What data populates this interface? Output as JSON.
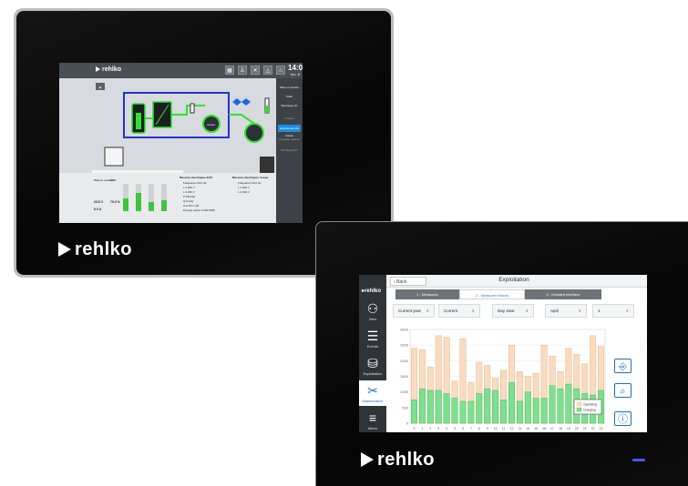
{
  "device1": {
    "brand": "rehlko",
    "screen": {
      "logo": "rehlko",
      "clock_time": "14:06",
      "clock_date": "lun. 8 Janv",
      "warning_text": "Vous pouvez ouvrir l'organe de coupure auxiliaire.",
      "tab_labels": [
        "Synthèse",
        "Mesures ECP",
        "Mesures Hôtes",
        "Sous-transformation",
        "Pilotes des batteries",
        "Aux. principales Transformations",
        "Etat"
      ],
      "side_menu": [
        {
          "label": "Mise en service",
          "highlight": false
        },
        {
          "label": "Trafic",
          "highlight": false
        },
        {
          "label": "Recharge AC",
          "highlight": false
        },
        {
          "label": "Groupe",
          "highlight": false
        },
        {
          "label": "Déploiement du réseau",
          "highlight": true
        },
        {
          "label": "Couplage alterné",
          "highlight": false
        },
        {
          "label": "Recharge DC",
          "highlight": false
        }
      ],
      "left_panel_labels": [
        "Batterie auxiliaire",
        "SOC",
        "23.8 V",
        "79.3 %",
        "0.0 A"
      ],
      "meas_title_1": "Mesures électriques ECP",
      "meas_title_2": "Mesures électriques réseau",
      "meas_rows_1": [
        "Fréquence 50.0 Hz",
        "L 1 400 V",
        "L 2 230 V",
        "P 150 kW",
        "Q 0 kvar",
        "Cos Phi 1.00",
        "Energie active 1.000 MWh"
      ],
      "meas_rows_2": [
        "Fréquence 50.0 Hz",
        "L 1 400 V",
        "L 2 230 V"
      ],
      "diagram_labels": [
        "230 kV",
        "Accumulateur",
        "Générateur",
        "3 kW"
      ]
    }
  },
  "device2": {
    "brand": "rehlko",
    "screen": {
      "logo": "rehlko",
      "back_label": "Back",
      "title": "Exploitation",
      "tabs": [
        {
          "label": "1 - Measures",
          "active": false
        },
        {
          "label": "2 - Measures history",
          "active": true
        },
        {
          "label": "3 - Detailed interface",
          "active": false
        }
      ],
      "selectors": [
        "Current year",
        "Current",
        "Day view",
        "April",
        "1"
      ],
      "sidebar": [
        {
          "label": "View",
          "icon": "people-icon",
          "active": false
        },
        {
          "label": "Events",
          "icon": "list-icon",
          "active": false
        },
        {
          "label": "Exploitation",
          "icon": "generator-icon",
          "active": false
        },
        {
          "label": "Maintenance",
          "icon": "wrench-icon",
          "active": true
        },
        {
          "label": "Menu",
          "icon": "menu-icon",
          "active": false
        }
      ],
      "action_buttons": [
        "export-icon",
        "zoom-icon",
        "info-icon"
      ]
    }
  },
  "colors": {
    "orange_bar": "#f9dcc0",
    "orange_border": "#e8b48a",
    "green_bar": "#7ee08e",
    "green_border": "#44b95c",
    "accent_blue": "#1e6fc0",
    "led": "#4f55e8"
  },
  "chart_data": {
    "type": "bar",
    "categories": [
      "0",
      "1",
      "2",
      "3",
      "4",
      "5",
      "6",
      "7",
      "8",
      "9",
      "10",
      "11",
      "12",
      "13",
      "14",
      "15",
      "16",
      "17",
      "18",
      "19",
      "20",
      "21",
      "22",
      "23"
    ],
    "ylim": [
      0,
      3000
    ],
    "yticks": [
      "3000",
      "2500",
      "2000",
      "1500",
      "1000",
      "500",
      "0"
    ],
    "series": [
      {
        "name": "Operating",
        "values": [
          2400,
          2350,
          1800,
          2800,
          2750,
          1350,
          2700,
          1300,
          1950,
          1850,
          1450,
          1700,
          2500,
          1650,
          1500,
          1600,
          2500,
          2150,
          1650,
          2400,
          2200,
          1900,
          2800,
          2450
        ]
      },
      {
        "name": "Charging",
        "values": [
          750,
          1100,
          1050,
          1050,
          950,
          800,
          700,
          700,
          950,
          1100,
          1050,
          750,
          1300,
          700,
          1000,
          800,
          800,
          1200,
          1100,
          1250,
          1100,
          950,
          900,
          1050
        ]
      }
    ]
  }
}
